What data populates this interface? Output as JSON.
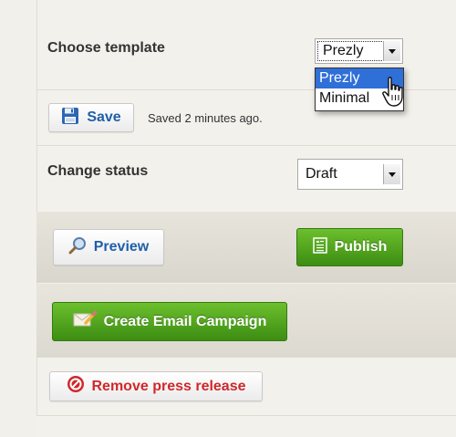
{
  "template": {
    "label": "Choose template",
    "selected": "Prezly",
    "options": [
      "Prezly",
      "Minimal"
    ]
  },
  "save": {
    "button_label": "Save",
    "status_text": "Saved 2 minutes ago."
  },
  "status": {
    "label": "Change status",
    "selected": "Draft"
  },
  "actions": {
    "preview_label": "Preview",
    "publish_label": "Publish",
    "email_campaign_label": "Create Email Campaign",
    "remove_label": "Remove press release"
  },
  "colors": {
    "green": "#4fa51d",
    "remove_red": "#d0282b",
    "link_blue": "#1f5fa8"
  },
  "icons": {
    "save": "floppy-disk-icon",
    "preview": "magnifier-icon",
    "publish": "document-icon",
    "email": "envelope-pencil-icon",
    "remove": "no-entry-icon",
    "cursor": "hand-pointer-cursor"
  }
}
